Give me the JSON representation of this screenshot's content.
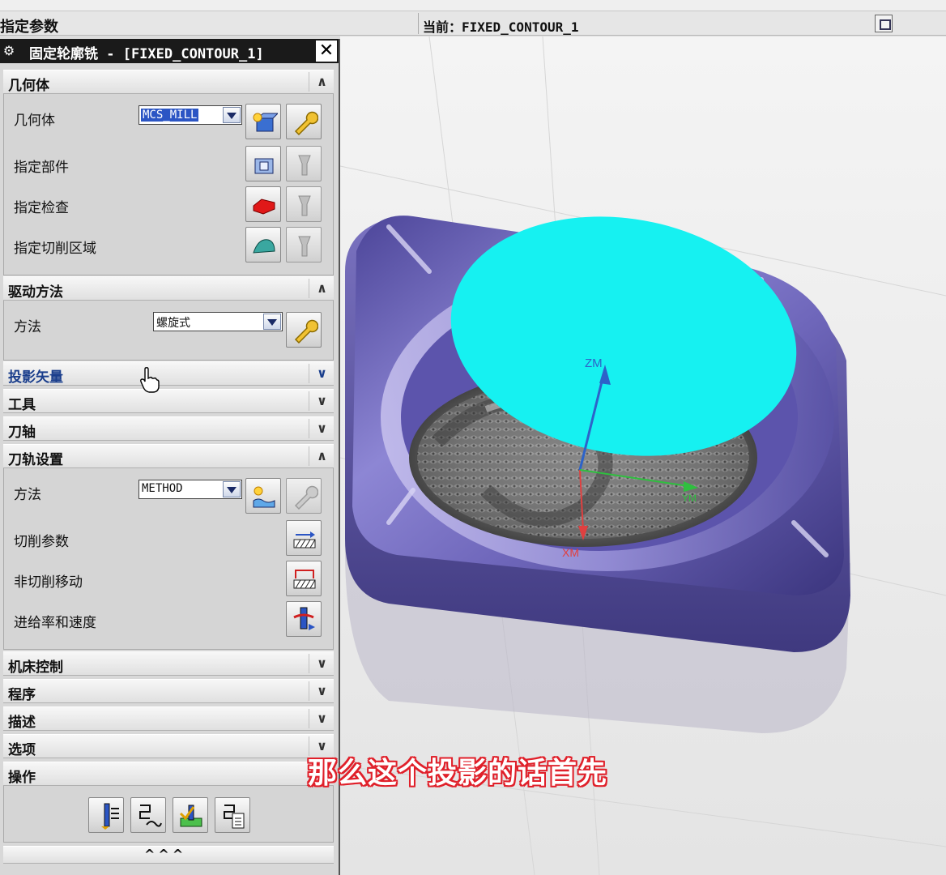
{
  "top_bar": {
    "left_label": "指定参数",
    "current_label": "当前：FIXED_CONTOUR_1"
  },
  "dialog": {
    "title": "固定轮廓铣 - [FIXED_CONTOUR_1]",
    "sections": {
      "geometry": {
        "header": "几何体",
        "geometry_label": "几何体",
        "geometry_value": "MCS_MILL",
        "specify_part": "指定部件",
        "specify_check": "指定检查",
        "specify_cut_area": "指定切削区域"
      },
      "drive_method": {
        "header": "驱动方法",
        "method_label": "方法",
        "method_value": "螺旋式"
      },
      "projection_vector": {
        "header": "投影矢量"
      },
      "tool": {
        "header": "工具"
      },
      "tool_axis": {
        "header": "刀轴"
      },
      "path_settings": {
        "header": "刀轨设置",
        "method_label": "方法",
        "method_value": "METHOD",
        "cutting_params": "切削参数",
        "non_cutting_moves": "非切削移动",
        "feeds_speeds": "进给率和速度"
      },
      "machine_control": {
        "header": "机床控制"
      },
      "program": {
        "header": "程序"
      },
      "description": {
        "header": "描述"
      },
      "options": {
        "header": "选项"
      },
      "actions": {
        "header": "操作"
      }
    },
    "collapse_label": "^^^"
  },
  "viewport": {
    "axis_z": "ZM",
    "axis_x": "XM",
    "axis_y": "YM",
    "colors": {
      "part": "#7f76c4",
      "disk": "#16f1f1",
      "axis_z": "#2d63c9",
      "axis_x": "#e04040",
      "axis_y": "#2fbf3f"
    }
  },
  "subtitle": "那么这个投影的话首先"
}
